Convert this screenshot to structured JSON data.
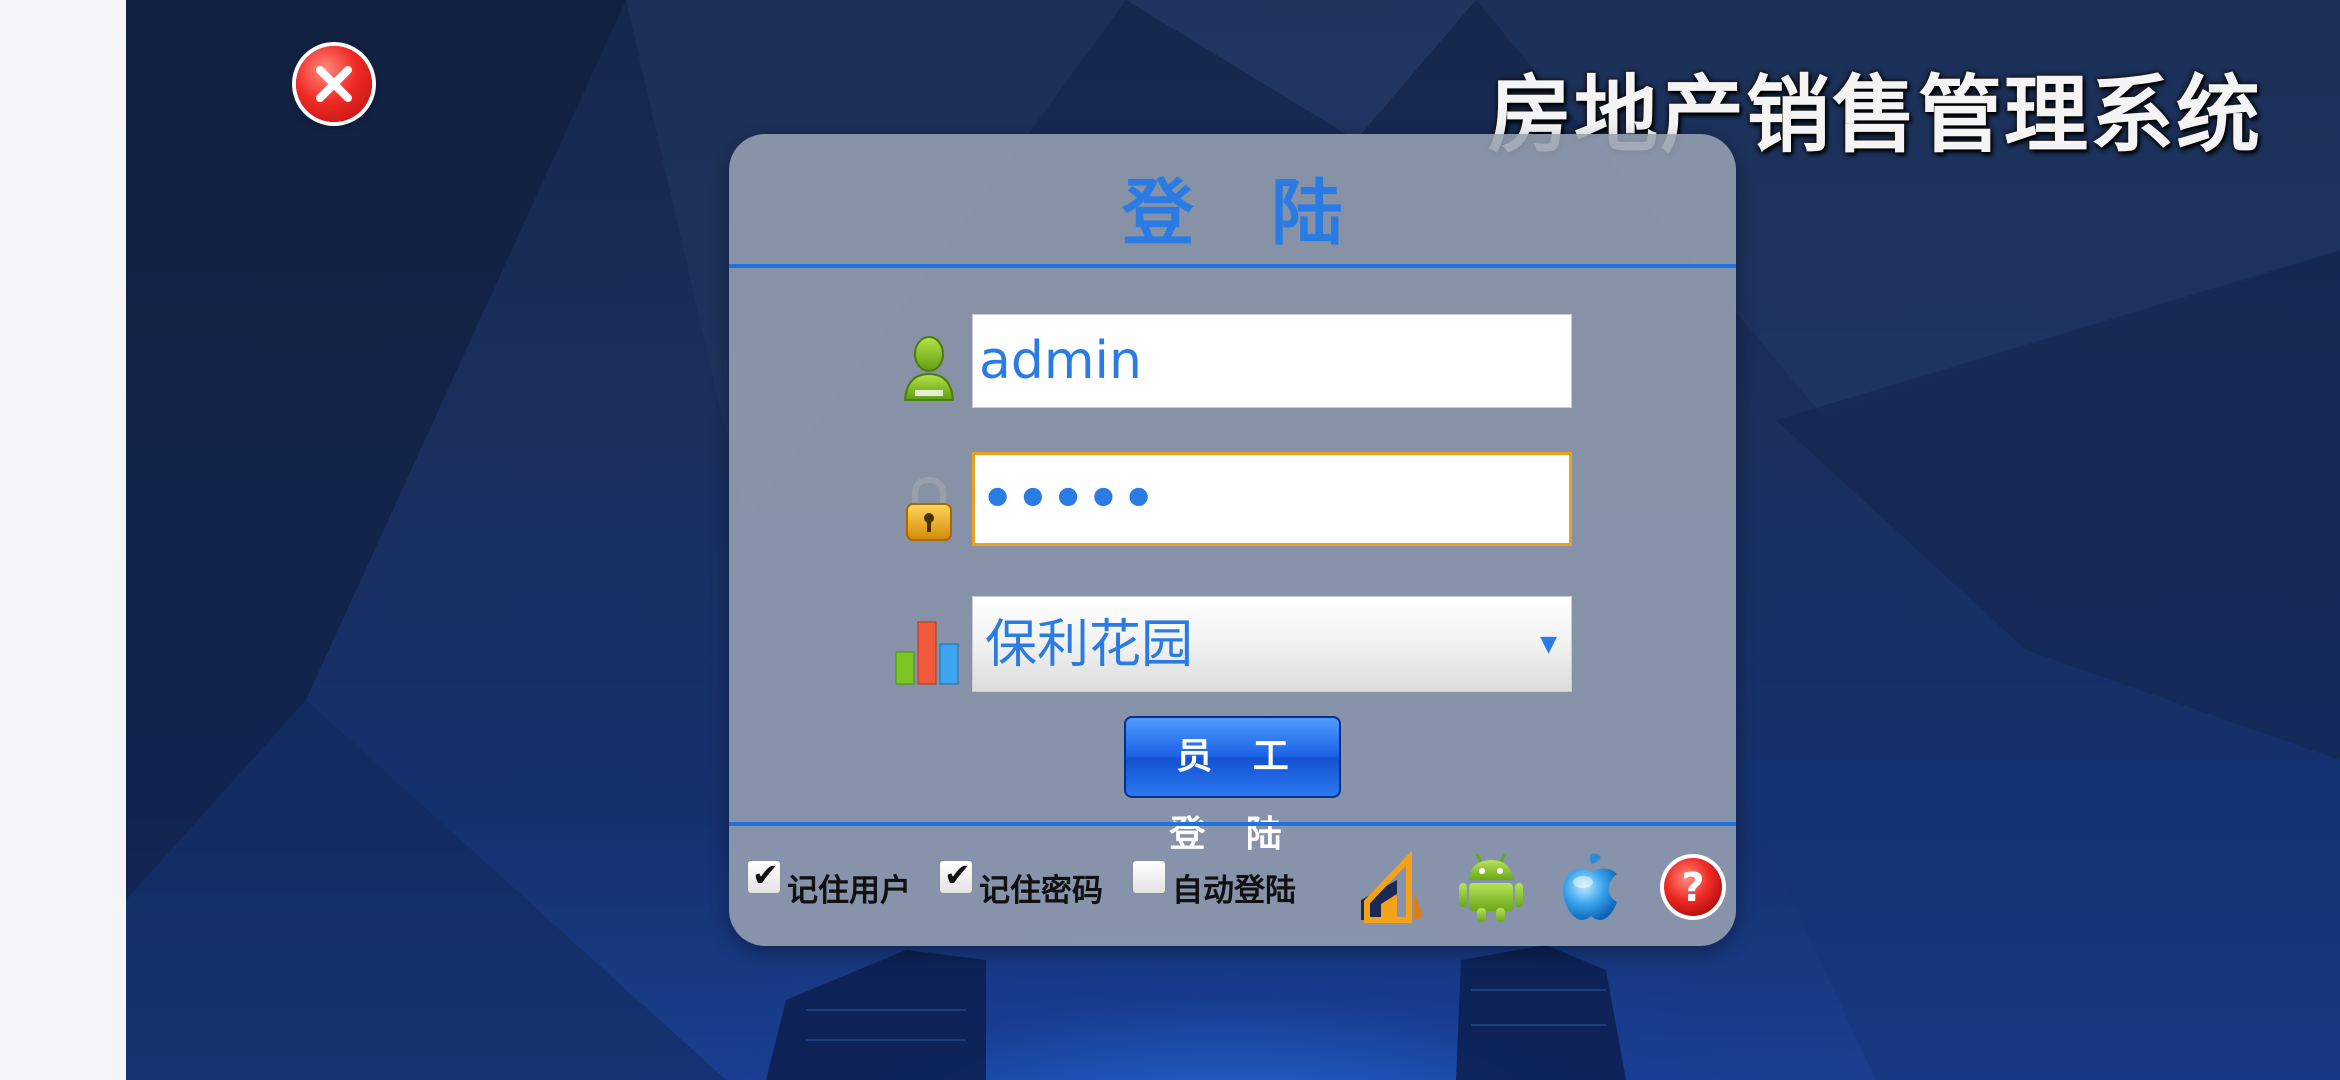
{
  "app": {
    "title": "房地产销售管理系统"
  },
  "login": {
    "heading": "登 陆",
    "username": "admin",
    "password_mask": "•••••",
    "project_selected": "保利花园",
    "submit_label": "员 工 登 陆"
  },
  "options": {
    "remember_user": {
      "label": "记住用户",
      "checked": true
    },
    "remember_password": {
      "label": "记住密码",
      "checked": true
    },
    "auto_login": {
      "label": "自动登陆",
      "checked": false
    }
  },
  "icons": {
    "close": "close-icon",
    "user": "user-icon",
    "lock": "lock-icon",
    "project": "bar-chart-icon",
    "company_logo": "building-logo-icon",
    "android": "android-icon",
    "apple": "apple-icon",
    "help": "help-icon"
  },
  "colors": {
    "accent": "#2a7be4",
    "divider": "#1f73e0",
    "focus_border": "#e8a222",
    "close_red": "#f02a24"
  }
}
